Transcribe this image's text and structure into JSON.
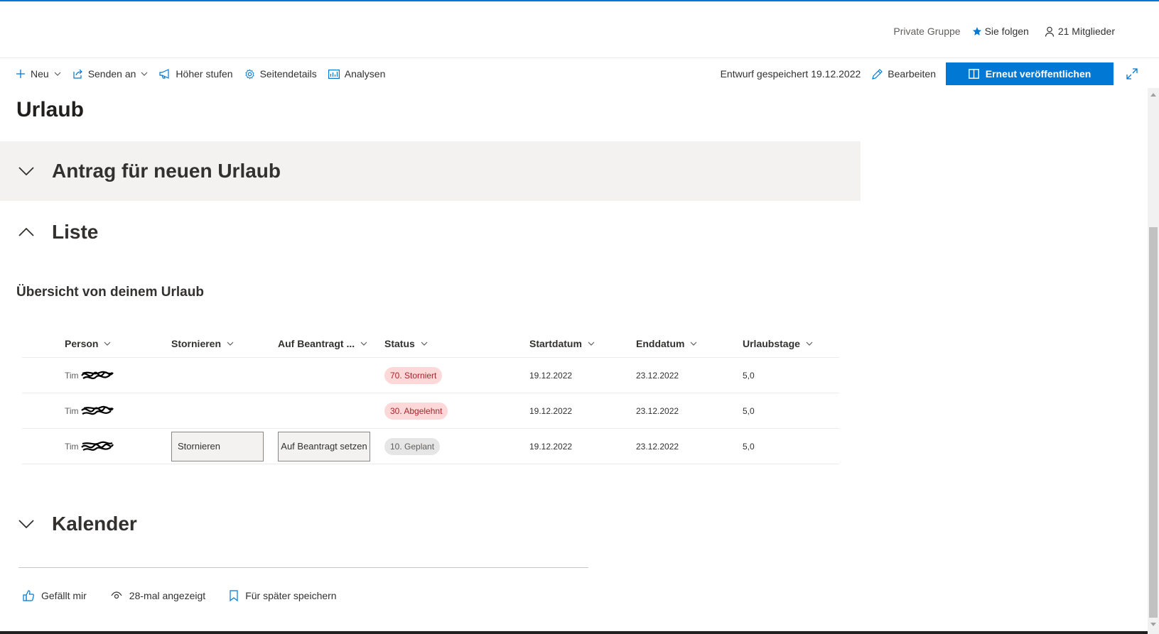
{
  "colors": {
    "accent": "#0078d4",
    "section_bg": "#f3f2f1",
    "pill_red_bg": "#fcd8d8",
    "pill_red_fg": "#a4262c",
    "pill_grey_bg": "#e6e6e6"
  },
  "header": {
    "group_type": "Private Gruppe",
    "follow_label": "Sie folgen",
    "members_label": "21 Mitglieder"
  },
  "commandbar": {
    "new_label": "Neu",
    "send_label": "Senden an",
    "promote_label": "Höher stufen",
    "details_label": "Seitendetails",
    "analytics_label": "Analysen",
    "draft_status": "Entwurf gespeichert 19.12.2022",
    "edit_label": "Bearbeiten",
    "publish_label": "Erneut veröffentlichen"
  },
  "page": {
    "title": "Urlaub",
    "sections": {
      "antrag": "Antrag für neuen Urlaub",
      "liste": "Liste",
      "kalender": "Kalender"
    },
    "list_heading": "Übersicht von deinem Urlaub"
  },
  "table": {
    "columns": [
      "Person",
      "Stornieren",
      "Auf Beantragt ...",
      "Status",
      "Startdatum",
      "Enddatum",
      "Urlaubstage"
    ],
    "rows": [
      {
        "person": "Tim",
        "status": "70. Storniert",
        "status_tone": "red",
        "start": "19.12.2022",
        "end": "23.12.2022",
        "days": "5,0"
      },
      {
        "person": "Tim",
        "status": "30. Abgelehnt",
        "status_tone": "red",
        "start": "19.12.2022",
        "end": "23.12.2022",
        "days": "5,0"
      },
      {
        "person": "Tim",
        "storn_button": "Stornieren",
        "auf_button": "Auf Beantragt setzen",
        "status": "10. Geplant",
        "status_tone": "grey",
        "start": "19.12.2022",
        "end": "23.12.2022",
        "days": "5,0"
      }
    ]
  },
  "footer": {
    "like_label": "Gefällt mir",
    "views_label": "28-mal angezeigt",
    "save_label": "Für später speichern"
  },
  "icons": [
    "star-icon",
    "person-icon",
    "plus-icon",
    "share-icon",
    "megaphone-icon",
    "gear-icon",
    "chart-icon",
    "pencil-icon",
    "book-icon",
    "expand-icon",
    "chevron-down-icon",
    "chevron-up-icon",
    "thumbs-up-icon",
    "eye-icon",
    "bookmark-icon"
  ]
}
